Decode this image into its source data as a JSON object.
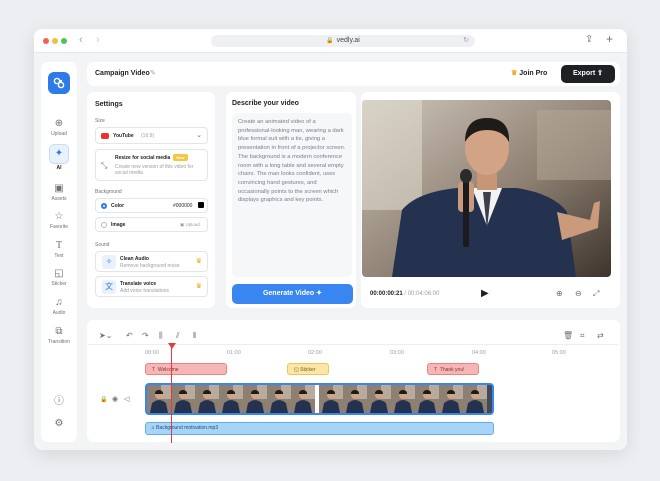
{
  "browser": {
    "url": "vedly.ai",
    "dots": [
      "#f0615a",
      "#f5be3f",
      "#4fc456"
    ]
  },
  "sidebar": {
    "items": [
      {
        "label": "Upload",
        "icon": "upload-icon"
      },
      {
        "label": "AI",
        "icon": "magic-wand-icon"
      },
      {
        "label": "Assets",
        "icon": "image-icon"
      },
      {
        "label": "Favorite",
        "icon": "star-icon"
      },
      {
        "label": "Text",
        "icon": "text-icon"
      },
      {
        "label": "Sticker",
        "icon": "sticker-icon"
      },
      {
        "label": "Audio",
        "icon": "music-icon"
      },
      {
        "label": "Transition",
        "icon": "transition-icon"
      }
    ]
  },
  "header": {
    "project_name": "Campaign Video",
    "join_pro": "Join Pro",
    "export": "Export"
  },
  "settings": {
    "title": "Settings",
    "size_label": "Size",
    "size_value": "YouTube",
    "size_ratio": "(16:9)",
    "resize_title": "Resize for social media",
    "resize_badge": "New",
    "resize_desc": "Create new version of this video for social media",
    "background_label": "Background",
    "color_label": "Color",
    "color_value": "#000000",
    "image_label": "Image",
    "image_action": "Upload",
    "sound_label": "Sound",
    "clean_audio_title": "Clean Audio",
    "clean_audio_desc": "Remove background noise",
    "translate_title": "Translate voice",
    "translate_desc": "Add voice translations"
  },
  "describe": {
    "title": "Describe your video",
    "text": "Create an animated video of a professional-looking man, wearing a dark blue formal suit with a tie, giving a presentation in front of a projector screen. The background is a modern conference room with a long table and several empty chairs. The man looks confident, uses convincing hand gestures, and occasionally points to the screen which displays graphics and key points.",
    "generate": "Generate Video"
  },
  "player": {
    "current": "00:00:00:21",
    "separator": "/",
    "total": "00:04:06:00"
  },
  "timeline": {
    "ruler": [
      "00:00",
      "01:00",
      "02:00",
      "03:00",
      "04:00",
      "05:00"
    ],
    "text_clips": [
      "Welcome",
      "Sticker",
      "Thank you!"
    ],
    "audio_clip": "Background motivation.mp3",
    "playhead_fraction": 0.09
  },
  "colors": {
    "accent": "#3a86f0",
    "dark": "#1f2024",
    "crown": "#f0a818"
  }
}
